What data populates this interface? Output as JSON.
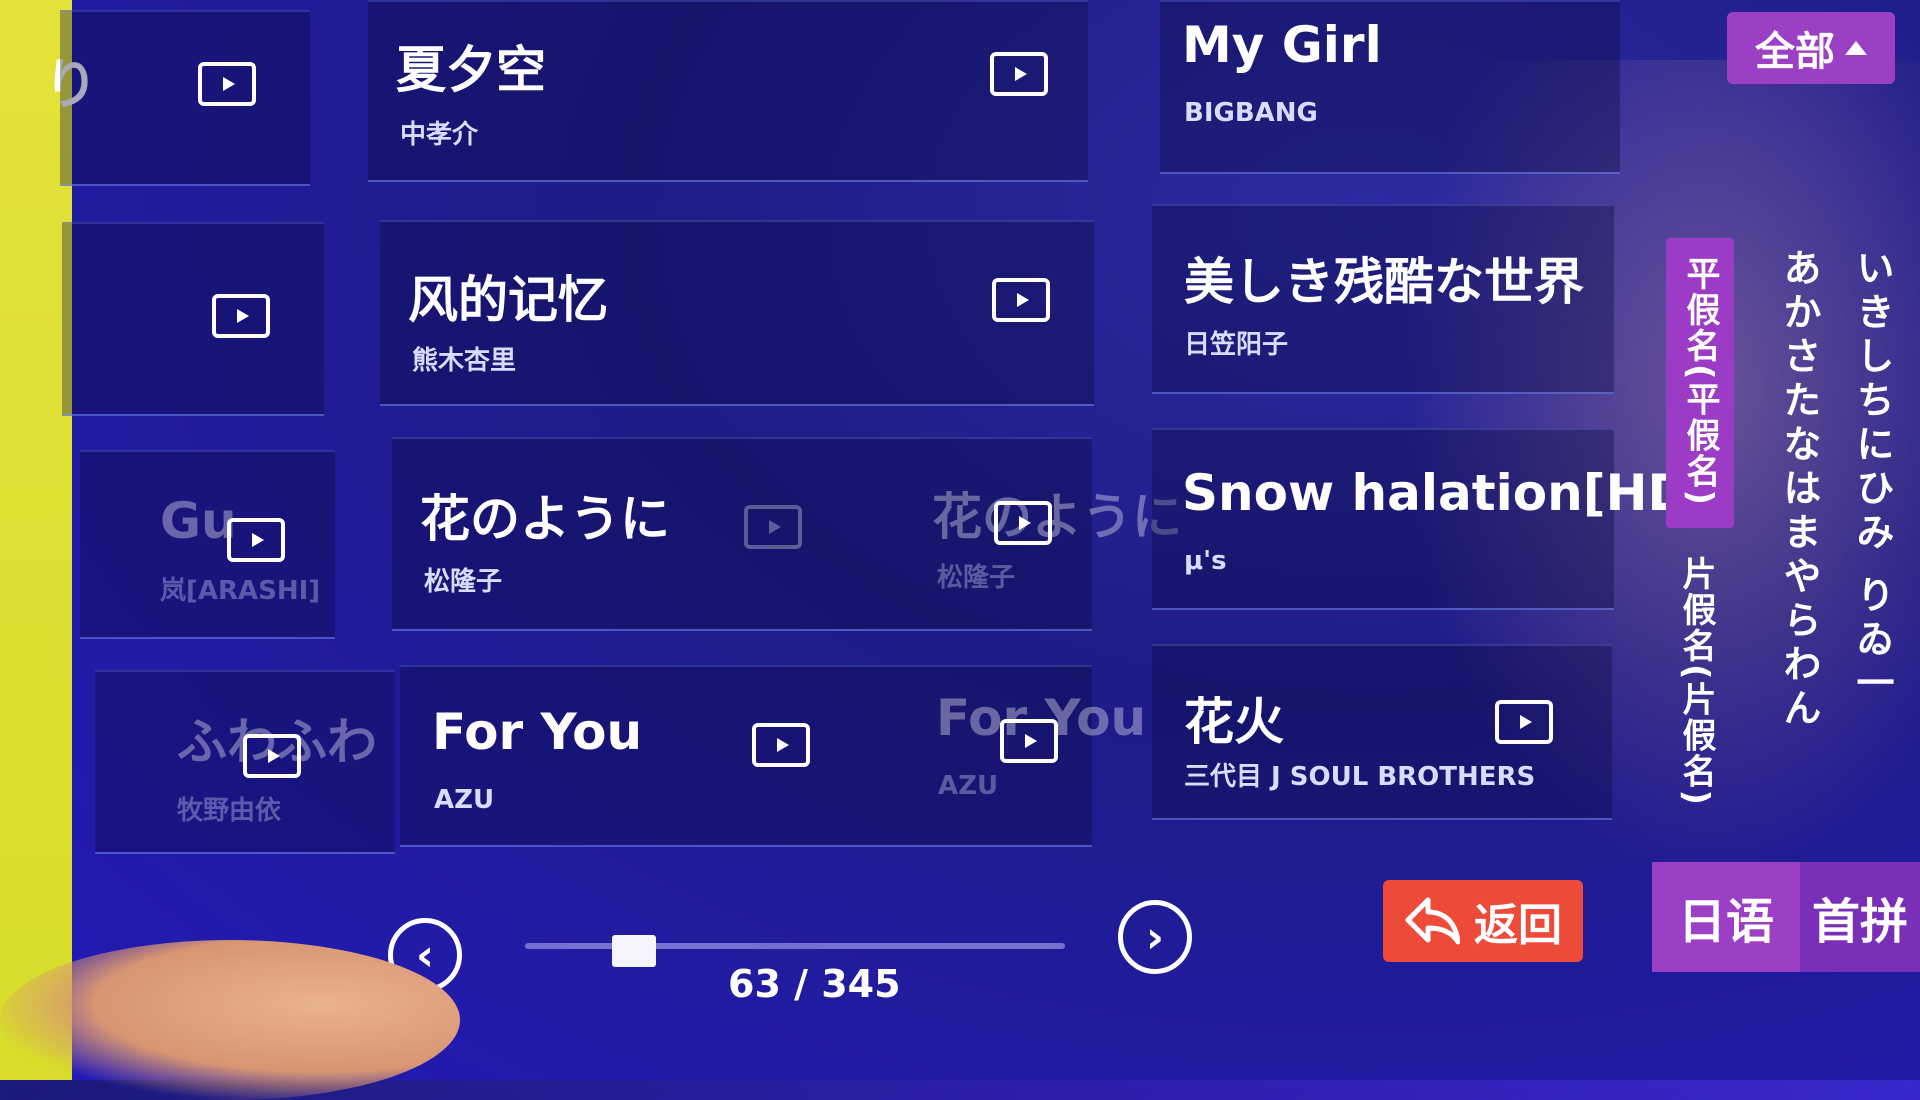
{
  "songs": [
    {
      "title": "夏夕空",
      "artist": "中孝介"
    },
    {
      "title": "My Girl",
      "artist": "BIGBANG"
    },
    {
      "title": "风的记忆",
      "artist": "熊木杏里"
    },
    {
      "title": "美しき残酷な世界",
      "artist": "日笠阳子"
    },
    {
      "title": "花のように",
      "artist": "松隆子"
    },
    {
      "title": "Snow halation[HD]",
      "artist": "μ's"
    },
    {
      "title": "For You",
      "artist": "AZU"
    },
    {
      "title": "花火",
      "artist": "三代目 J SOUL BROTHERS"
    }
  ],
  "ghosts": [
    {
      "title": "Gu",
      "artist": "岚[ARASHI]"
    },
    {
      "title": "ふわふわ",
      "artist": "牧野由依"
    },
    {
      "title": "花のように",
      "artist": "松隆子"
    },
    {
      "title": "For You",
      "artist": "AZU"
    }
  ],
  "left_marker": "り",
  "filter_button": {
    "label": "全部"
  },
  "kana_index": {
    "hiragana_tab": "平假名(平假名)",
    "katakana_tab": "片假名(片假名)",
    "column_a": "あかさたなはまやらわん",
    "column_i": "いきしちにひみ りゐ一"
  },
  "pagination": {
    "current": 63,
    "total": 345,
    "display": "63 / 345",
    "prev_icon": "‹",
    "next_icon": "›"
  },
  "back_button": {
    "label": "返回"
  },
  "language_tabs": [
    {
      "label": "日语",
      "active": true
    },
    {
      "label": "首拼",
      "active": false
    }
  ],
  "colors": {
    "accent_purple": "#9b3fc5",
    "back_red": "#ee4a3a"
  }
}
